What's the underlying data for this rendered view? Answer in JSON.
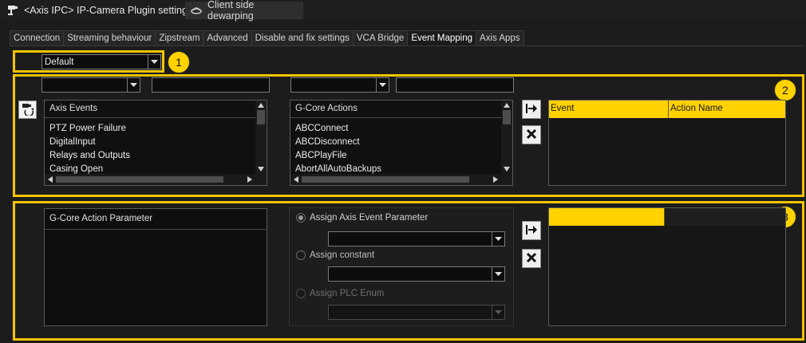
{
  "titlebar": {
    "plugin_title": "<Axis IPC> IP-Camera Plugin settings",
    "dewarp_title": "Client side dewarping"
  },
  "tabs": [
    {
      "label": "Connection"
    },
    {
      "label": "Streaming behaviour"
    },
    {
      "label": "Zipstream"
    },
    {
      "label": "Advanced"
    },
    {
      "label": "Disable and fix settings"
    },
    {
      "label": "VCA Bridge"
    },
    {
      "label": "Event Mapping",
      "active": true
    },
    {
      "label": "Axis Apps"
    }
  ],
  "profile": {
    "value": "Default"
  },
  "badges": [
    "1",
    "2",
    "3"
  ],
  "axis_events": {
    "header": "Axis Events",
    "items": [
      "PTZ Power Failure",
      "DigitalInput",
      "Relays and Outputs",
      "Casing Open"
    ]
  },
  "gcore_actions": {
    "header": "G-Core Actions",
    "items": [
      "ABCConnect",
      "ABCDisconnect",
      "ABCPlayFile",
      "AbortAllAutoBackups"
    ]
  },
  "mapping_table": {
    "columns": [
      "Event",
      "Action Name"
    ]
  },
  "parameter_panel": {
    "header": "G-Core Action Parameter"
  },
  "assign": {
    "axis_event_parameter": "Assign Axis Event Parameter",
    "constant": "Assign constant",
    "plc_enum": "Assign PLC Enum"
  },
  "icons": {
    "plugin": "camera-plugin-icon",
    "dewarp": "dewarp-icon",
    "refresh": "camera-refresh-icon",
    "map": "map-arrow-icon",
    "remove": "remove-x-icon"
  },
  "colors": {
    "highlight": "#f4c400",
    "badge": "#ffd200",
    "background": "#1c1c1c"
  }
}
